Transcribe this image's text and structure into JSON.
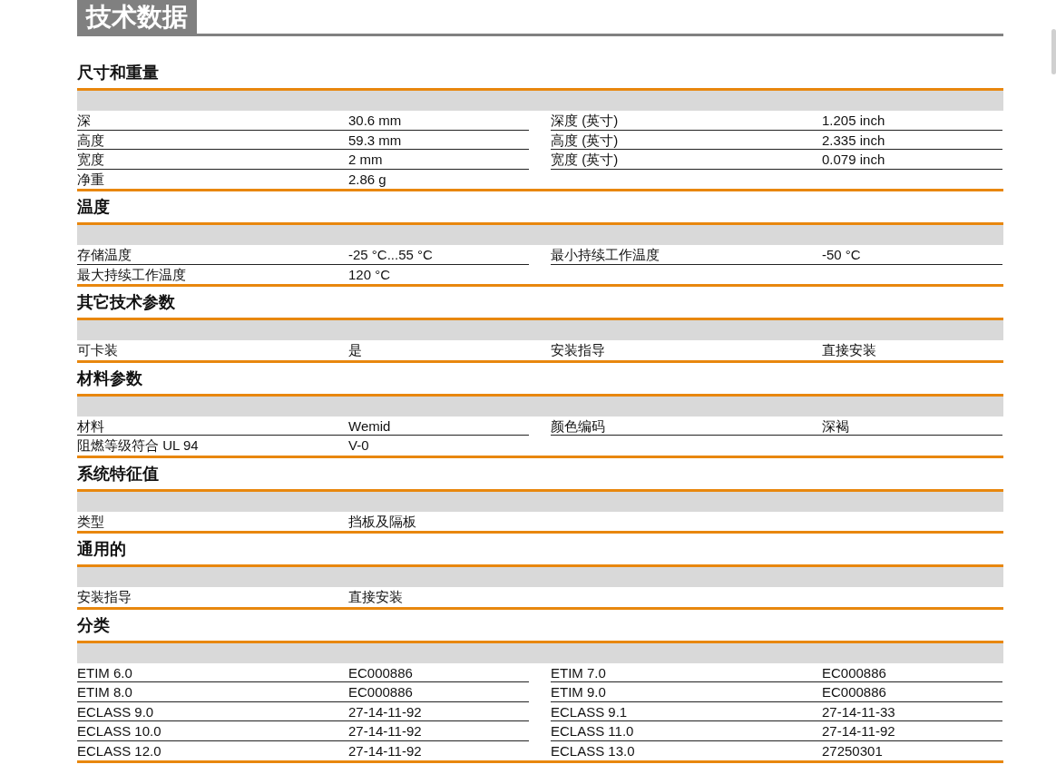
{
  "title": "技术数据",
  "sections": [
    {
      "title": "尺寸和重量",
      "left": [
        {
          "label": "深",
          "value": "30.6 mm"
        },
        {
          "label": "高度",
          "value": "59.3 mm"
        },
        {
          "label": "宽度",
          "value": "2 mm"
        },
        {
          "label": "净重",
          "value": "2.86 g"
        }
      ],
      "right": [
        {
          "label": "深度 (英寸)",
          "value": "1.205 inch"
        },
        {
          "label": "高度 (英寸)",
          "value": "2.335 inch"
        },
        {
          "label": "宽度 (英寸)",
          "value": "0.079 inch"
        }
      ]
    },
    {
      "title": "温度",
      "left": [
        {
          "label": "存储温度",
          "value": "-25 °C...55 °C"
        },
        {
          "label": "最大持续工作温度",
          "value": "120 °C"
        }
      ],
      "right": [
        {
          "label": "最小持续工作温度",
          "value": "-50 °C"
        }
      ]
    },
    {
      "title": "其它技术参数",
      "left": [
        {
          "label": "可卡装",
          "value": "是"
        }
      ],
      "right": [
        {
          "label": "安装指导",
          "value": "直接安装"
        }
      ]
    },
    {
      "title": "材料参数",
      "left": [
        {
          "label": "材料",
          "value": "Wemid"
        },
        {
          "label": "阻燃等级符合 UL 94",
          "value": "V-0"
        }
      ],
      "right": [
        {
          "label": "颜色编码",
          "value": "深褐"
        }
      ]
    },
    {
      "title": "系统特征值",
      "left": [
        {
          "label": "类型",
          "value": "挡板及隔板"
        }
      ]
    },
    {
      "title": "通用的",
      "left": [
        {
          "label": "安装指导",
          "value": "直接安装"
        }
      ]
    },
    {
      "title": "分类",
      "left": [
        {
          "label": "ETIM 6.0",
          "value": "EC000886"
        },
        {
          "label": "ETIM 8.0",
          "value": "EC000886"
        },
        {
          "label": "ECLASS 9.0",
          "value": "27-14-11-92"
        },
        {
          "label": "ECLASS 10.0",
          "value": "27-14-11-92"
        },
        {
          "label": "ECLASS 12.0",
          "value": "27-14-11-92"
        }
      ],
      "right": [
        {
          "label": "ETIM 7.0",
          "value": "EC000886"
        },
        {
          "label": "ETIM 9.0",
          "value": "EC000886"
        },
        {
          "label": "ECLASS 9.1",
          "value": "27-14-11-33"
        },
        {
          "label": "ECLASS 11.0",
          "value": "27-14-11-92"
        },
        {
          "label": "ECLASS 13.0",
          "value": "27250301"
        }
      ]
    }
  ]
}
